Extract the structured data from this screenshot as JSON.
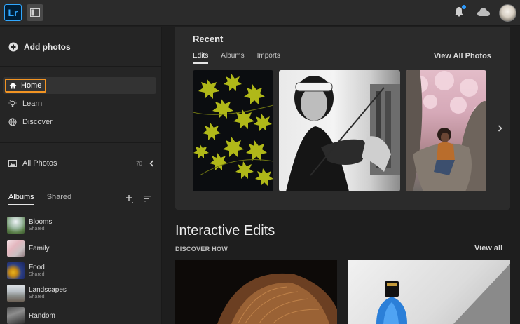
{
  "app": {
    "logo": "Lr"
  },
  "topbar": {
    "icons": [
      "panel-toggle-icon",
      "bell-icon",
      "cloud-icon",
      "avatar"
    ]
  },
  "sidebar": {
    "add_photos": "Add photos",
    "nav": [
      {
        "label": "Home",
        "icon": "home-icon",
        "selected": true
      },
      {
        "label": "Learn",
        "icon": "lightbulb-icon"
      },
      {
        "label": "Discover",
        "icon": "globe-icon"
      }
    ],
    "all_photos": {
      "label": "All Photos",
      "count": "70",
      "icon": "photo-icon"
    },
    "album_tabs": {
      "albums": "Albums",
      "shared": "Shared"
    },
    "albums": [
      {
        "name": "Blooms",
        "sub": "Shared"
      },
      {
        "name": "Family",
        "sub": ""
      },
      {
        "name": "Food",
        "sub": "Shared"
      },
      {
        "name": "Landscapes",
        "sub": "Shared"
      },
      {
        "name": "Random",
        "sub": ""
      }
    ]
  },
  "recent": {
    "title": "Recent",
    "tabs": [
      "Edits",
      "Albums",
      "Imports"
    ],
    "active_tab": "Edits",
    "view_all": "View All Photos"
  },
  "interactive": {
    "title": "Interactive Edits",
    "subtitle": "DISCOVER HOW",
    "view_all": "View all"
  },
  "colors": {
    "accent_selection": "#f29423",
    "notification_dot": "#2d9bff",
    "lr_blue": "#31a8ff"
  }
}
